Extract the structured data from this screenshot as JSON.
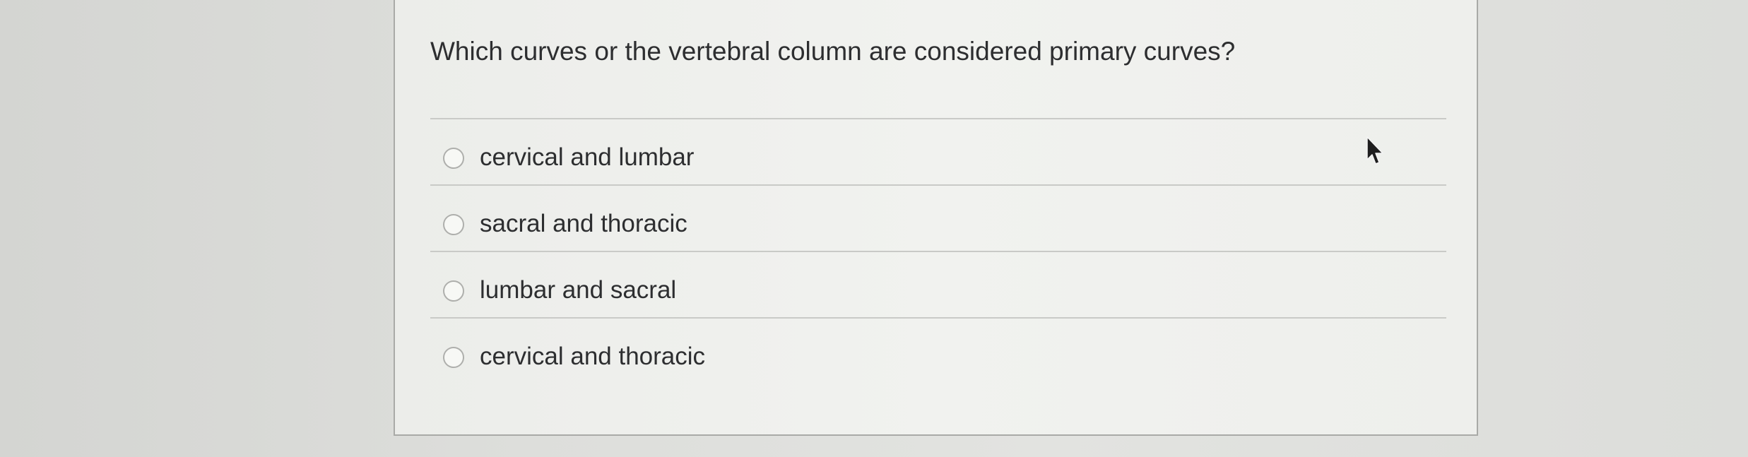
{
  "question": {
    "text": "Which curves or the vertebral column are considered primary curves?"
  },
  "options": [
    {
      "label": "cervical and lumbar",
      "selected": false
    },
    {
      "label": "sacral and thoracic",
      "selected": false
    },
    {
      "label": "lumbar and sacral",
      "selected": false
    },
    {
      "label": "cervical and thoracic",
      "selected": false
    }
  ],
  "colors": {
    "text": "#2d2e30",
    "panel_background": "#f0f1ee",
    "page_background": "#dcddda",
    "divider": "#c9cac7",
    "panel_border": "#a9aaa7"
  },
  "icons": {
    "radio": "radio-button-icon",
    "cursor": "mouse-pointer-icon"
  }
}
